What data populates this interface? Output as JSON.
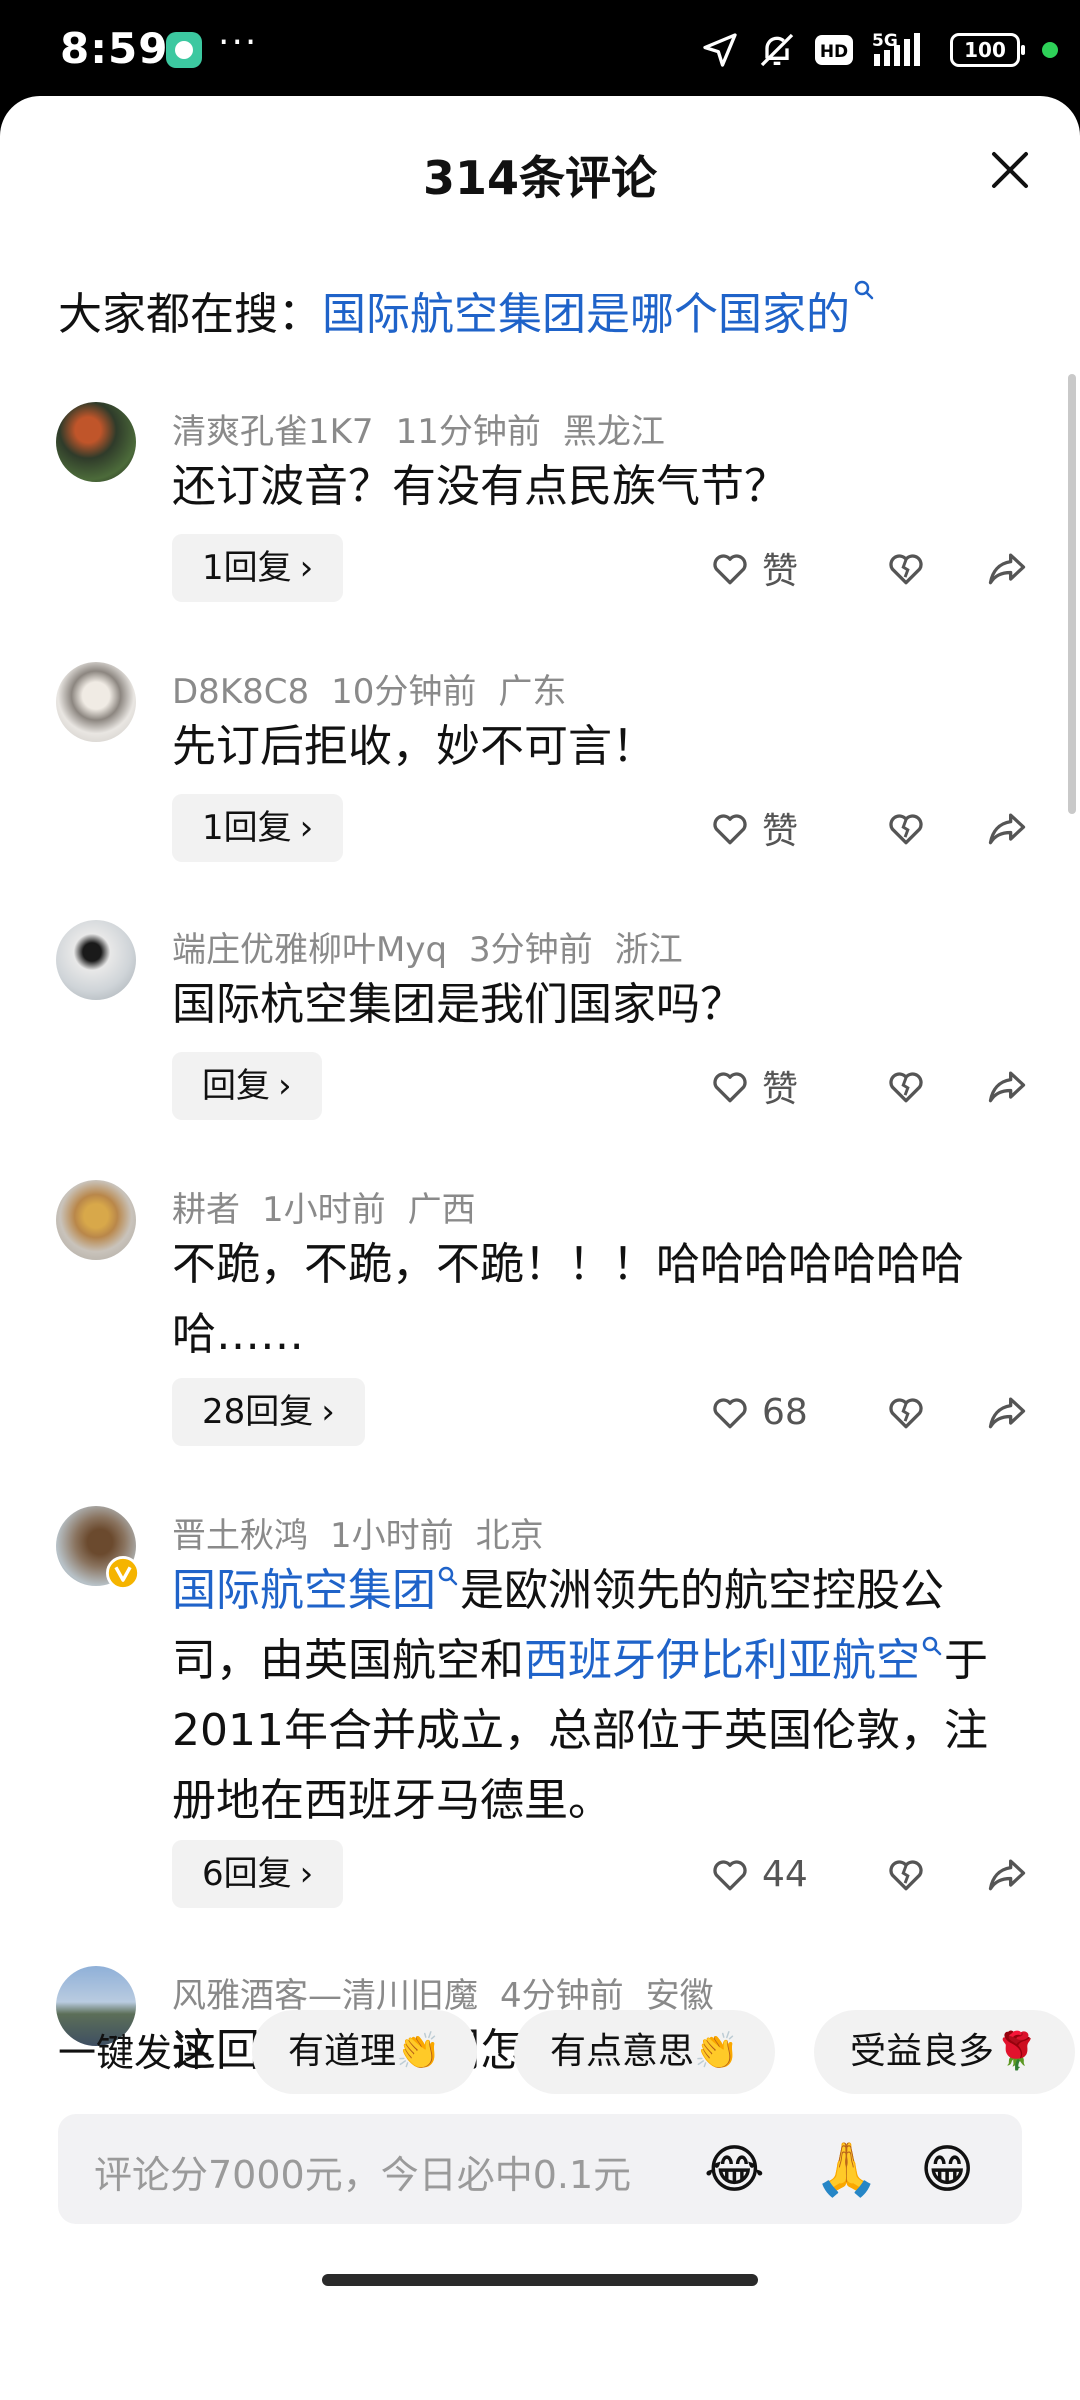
{
  "status_bar": {
    "time": "8:59",
    "more": "···",
    "network": "5G",
    "hd": "HD",
    "battery": "100",
    "icons": [
      "location-arrow-icon",
      "mute-icon",
      "hd-icon",
      "signal-icon",
      "battery-icon"
    ],
    "dot_color": "#2ed158"
  },
  "sheet": {
    "title": "314条评论",
    "hot_search_label": "大家都在搜：",
    "hot_search_link": "国际航空集团是哪个国家的"
  },
  "comments": [
    {
      "user": "清爽孔雀1K7",
      "time": "11分钟前",
      "region": "黑龙江",
      "text": "还订波音？有没有点民族气节？",
      "reply": "1回复",
      "like": "赞"
    },
    {
      "user": "D8K8C8",
      "time": "10分钟前",
      "region": "广东",
      "text": "先订后拒收，妙不可言！",
      "reply": "1回复",
      "like": "赞"
    },
    {
      "user": "端庄优雅柳叶Myq",
      "time": "3分钟前",
      "region": "浙江",
      "text": "国际杭空集团是我们国家吗？",
      "reply": "回复",
      "like": "赞"
    },
    {
      "user": "耕者",
      "time": "1小时前",
      "region": "广西",
      "text": "不跪，不跪，不跪！！！哈哈哈哈哈哈哈哈……",
      "reply": "28回复",
      "like": "68"
    },
    {
      "user": "晋土秋鸿",
      "time": "1小时前",
      "region": "北京",
      "text_link1": "国际航空集团",
      "text_part1": "是欧洲领先的航空控股公司，由英国航空和",
      "text_link2": "西班牙伊比利亚航空",
      "text_part2": "于2011年合并成立，总部位于英国伦敦，注册地在西班牙马德里。",
      "reply": "6回复",
      "like": "44",
      "verified_color": "#f5b400"
    },
    {
      "user": "风雅酒客—清川旧魔",
      "time": "4分钟前",
      "region": "安徽",
      "text": "这回旋镖让他们怎么承受得了！"
    }
  ],
  "quick_replies": {
    "label": "一键发评",
    "chips": [
      "有道理👏",
      "有点意思👏",
      "受益良多🌹"
    ]
  },
  "input": {
    "placeholder": "评论分7000元，今日必中0.1元",
    "emojis": [
      "😂",
      "🙏",
      "😁"
    ]
  },
  "colors": {
    "link": "#1f63c9",
    "meta": "#8a8a8a",
    "chip_bg": "#f2f2f2"
  }
}
